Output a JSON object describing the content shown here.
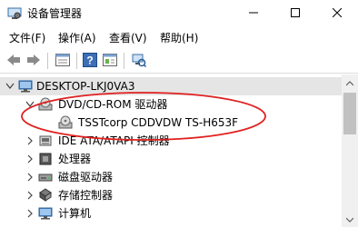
{
  "window": {
    "title": "设备管理器",
    "controls": {
      "minimize": "minimize-icon",
      "maximize": "maximize-icon",
      "close": "close-icon"
    }
  },
  "menu": [
    "文件(F)",
    "操作(A)",
    "查看(V)",
    "帮助(H)"
  ],
  "toolbar": [
    "back-arrow-icon",
    "forward-arrow-icon",
    "properties-panel-icon",
    "help-icon",
    "view-panel-icon",
    "scan-hardware-icon"
  ],
  "tree": {
    "root": "DESKTOP-LKJ0VA3",
    "nodes": [
      {
        "label": "DVD/CD-ROM 驱动器",
        "expanded": true,
        "icon": "optical-drive-icon"
      },
      {
        "label": "TSSTcorp CDDVDW TS-H653F",
        "child": true,
        "icon": "optical-disc-icon"
      },
      {
        "label": "IDE ATA/ATAPI 控制器",
        "expanded": false,
        "icon": "ide-controller-icon"
      },
      {
        "label": "处理器",
        "expanded": false,
        "icon": "processor-icon"
      },
      {
        "label": "磁盘驱动器",
        "expanded": false,
        "icon": "disk-drive-icon"
      },
      {
        "label": "存储控制器",
        "expanded": false,
        "icon": "storage-controller-icon"
      },
      {
        "label": "计算机",
        "expanded": false,
        "icon": "computer-icon"
      }
    ]
  },
  "colors": {
    "annotation": "#e02020",
    "selection": "#e5e5e5",
    "toolbar_icon": "#3c6fb5"
  }
}
